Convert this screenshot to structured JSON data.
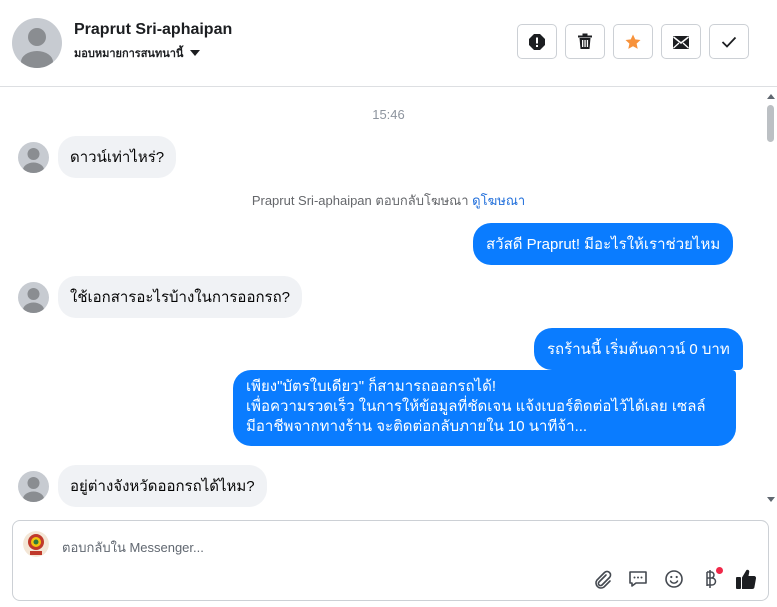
{
  "header": {
    "contact_name": "Praprut Sri-aphaipan",
    "assign_label": "มอบหมายการสนทนานี้",
    "actions": [
      {
        "icon": "alert-icon",
        "name": "spam-button"
      },
      {
        "icon": "trash-icon",
        "name": "delete-button"
      },
      {
        "icon": "star-icon",
        "name": "follow-up-button",
        "color": "#f7923b"
      },
      {
        "icon": "mark-unread-icon",
        "name": "mark-unread-button"
      },
      {
        "icon": "check-icon",
        "name": "mark-done-button"
      }
    ]
  },
  "thread": {
    "timestamp": "15:46",
    "messages": [
      {
        "from": "contact",
        "text": "ดาวน์เท่าไหร่?"
      },
      {
        "from": "contact",
        "text": "ใช้เอกสารอะไรบ้างในการออกรถ?"
      },
      {
        "from": "contact",
        "text": "อยู่ต่างจังหวัดออกรถได้ไหม?"
      }
    ],
    "notice": {
      "text": "Praprut Sri-aphaipan ตอบกลับโฆษณา",
      "link": "ดูโฆษณา"
    },
    "replies": {
      "greeting": "สวัสดี Praprut! มีอะไรให้เราช่วยไหม",
      "down_payment": "รถร้านนี้ เริ่มต้นดาวน์ 0 บาท",
      "lines": [
        "เพียง\"บัตรใบเดียว\" ก็สามารถออกรถได้!",
        "เพื่อความรวดเร็ว ในการให้ข้อมูลที่ชัดเจน แจ้งเบอร์ติดต่อไว้ได้เลย เซลล์",
        "มีอาชีพจากทางร้าน จะติดต่อกลับภายใน 10 นาทีจ้า..."
      ]
    }
  },
  "composer": {
    "placeholder": "ตอบกลับใน Messenger...",
    "tools": [
      "attach-icon",
      "saved-reply-icon",
      "emoji-icon",
      "baht-icon",
      "thumbs-up-icon"
    ]
  },
  "colors": {
    "accent": "#0a7cff",
    "incoming_bubble": "#f0f2f5",
    "star": "#f7923b",
    "link": "#216fdb"
  }
}
